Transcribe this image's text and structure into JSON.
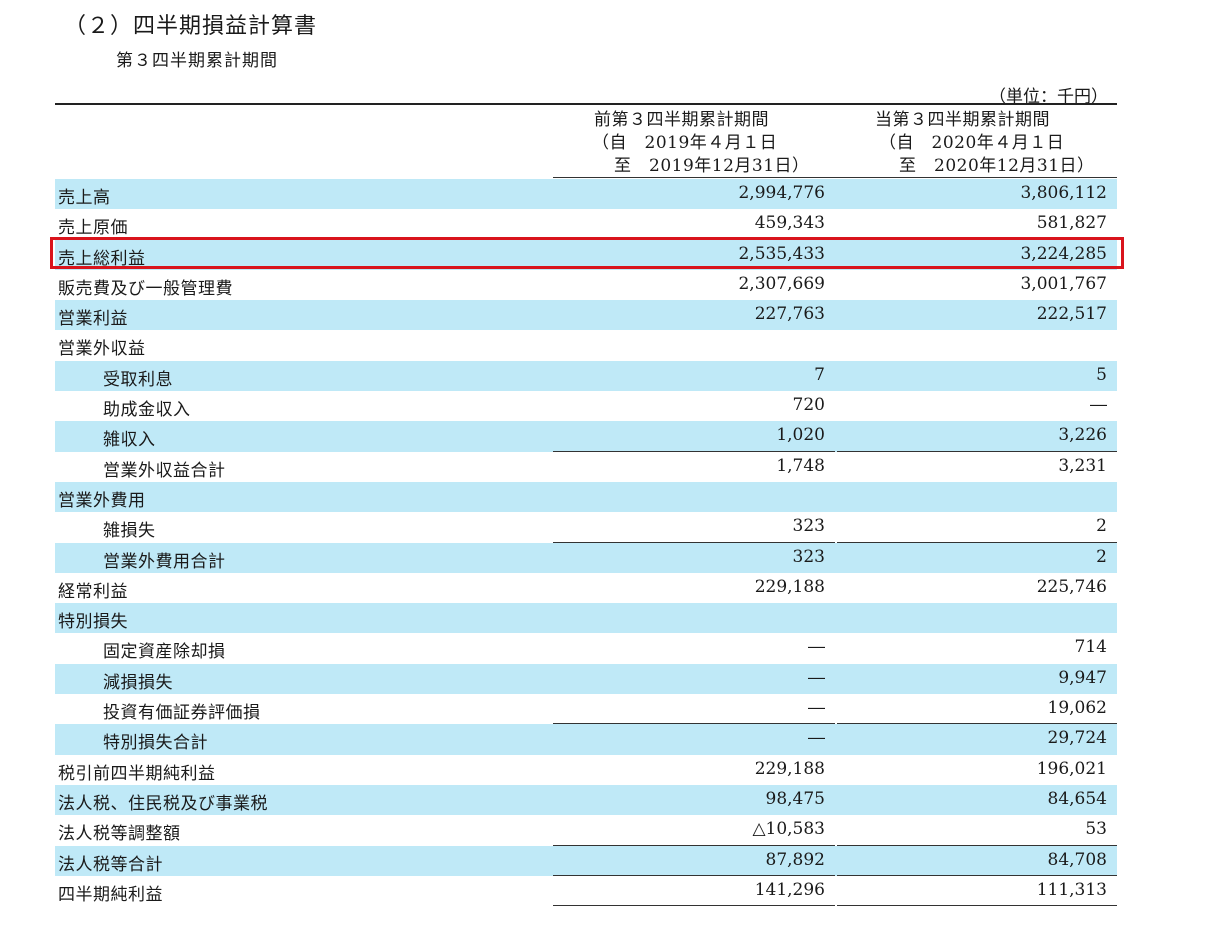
{
  "title": "（２）四半期損益計算書",
  "subtitle": "第３四半期累計期間",
  "unit": "（単位：千円）",
  "columns": {
    "prev": {
      "line1": "前第３四半期累計期間",
      "line2": "（自　2019年４月１日",
      "line3": "至　2019年12月31日）"
    },
    "curr": {
      "line1": "当第３四半期累計期間",
      "line2": "（自　2020年４月１日",
      "line3": "至　2020年12月31日）"
    }
  },
  "highlight_color": "#d9141c",
  "band_color": "#bfe9f7",
  "rows": [
    {
      "label": "売上高",
      "prev": "2,994,776",
      "curr": "3,806,112",
      "indent": false,
      "blue": true,
      "rule_prev": false,
      "rule_curr": false
    },
    {
      "label": "売上原価",
      "prev": "459,343",
      "curr": "581,827",
      "indent": false,
      "blue": false,
      "rule_prev": false,
      "rule_curr": false
    },
    {
      "label": "売上総利益",
      "prev": "2,535,433",
      "curr": "3,224,285",
      "indent": false,
      "blue": true,
      "rule_prev": false,
      "rule_curr": false,
      "highlighted": true
    },
    {
      "label": "販売費及び一般管理費",
      "prev": "2,307,669",
      "curr": "3,001,767",
      "indent": false,
      "blue": false,
      "rule_prev": false,
      "rule_curr": false
    },
    {
      "label": "営業利益",
      "prev": "227,763",
      "curr": "222,517",
      "indent": false,
      "blue": true,
      "rule_prev": false,
      "rule_curr": false
    },
    {
      "label": "営業外収益",
      "prev": "",
      "curr": "",
      "indent": false,
      "blue": false,
      "rule_prev": false,
      "rule_curr": false
    },
    {
      "label": "受取利息",
      "prev": "7",
      "curr": "5",
      "indent": true,
      "blue": true,
      "rule_prev": false,
      "rule_curr": false
    },
    {
      "label": "助成金収入",
      "prev": "720",
      "curr": "―",
      "indent": true,
      "blue": false,
      "rule_prev": false,
      "rule_curr": false
    },
    {
      "label": "雑収入",
      "prev": "1,020",
      "curr": "3,226",
      "indent": true,
      "blue": true,
      "rule_prev": true,
      "rule_curr": true
    },
    {
      "label": "営業外収益合計",
      "prev": "1,748",
      "curr": "3,231",
      "indent": true,
      "blue": false,
      "rule_prev": false,
      "rule_curr": false
    },
    {
      "label": "営業外費用",
      "prev": "",
      "curr": "",
      "indent": false,
      "blue": true,
      "rule_prev": false,
      "rule_curr": false
    },
    {
      "label": "雑損失",
      "prev": "323",
      "curr": "2",
      "indent": true,
      "blue": false,
      "rule_prev": true,
      "rule_curr": true
    },
    {
      "label": "営業外費用合計",
      "prev": "323",
      "curr": "2",
      "indent": true,
      "blue": true,
      "rule_prev": false,
      "rule_curr": false
    },
    {
      "label": "経常利益",
      "prev": "229,188",
      "curr": "225,746",
      "indent": false,
      "blue": false,
      "rule_prev": false,
      "rule_curr": false
    },
    {
      "label": "特別損失",
      "prev": "",
      "curr": "",
      "indent": false,
      "blue": true,
      "rule_prev": false,
      "rule_curr": false
    },
    {
      "label": "固定資産除却損",
      "prev": "―",
      "curr": "714",
      "indent": true,
      "blue": false,
      "rule_prev": false,
      "rule_curr": false
    },
    {
      "label": "減損損失",
      "prev": "―",
      "curr": "9,947",
      "indent": true,
      "blue": true,
      "rule_prev": false,
      "rule_curr": false
    },
    {
      "label": "投資有価証券評価損",
      "prev": "―",
      "curr": "19,062",
      "indent": true,
      "blue": false,
      "rule_prev": true,
      "rule_curr": true
    },
    {
      "label": "特別損失合計",
      "prev": "―",
      "curr": "29,724",
      "indent": true,
      "blue": true,
      "rule_prev": false,
      "rule_curr": false
    },
    {
      "label": "税引前四半期純利益",
      "prev": "229,188",
      "curr": "196,021",
      "indent": false,
      "blue": false,
      "rule_prev": false,
      "rule_curr": false
    },
    {
      "label": "法人税、住民税及び事業税",
      "prev": "98,475",
      "curr": "84,654",
      "indent": false,
      "blue": true,
      "rule_prev": false,
      "rule_curr": false
    },
    {
      "label": "法人税等調整額",
      "prev": "△10,583",
      "curr": "53",
      "indent": false,
      "blue": false,
      "rule_prev": true,
      "rule_curr": true
    },
    {
      "label": "法人税等合計",
      "prev": "87,892",
      "curr": "84,708",
      "indent": false,
      "blue": true,
      "rule_prev": true,
      "rule_curr": true
    },
    {
      "label": "四半期純利益",
      "prev": "141,296",
      "curr": "111,313",
      "indent": false,
      "blue": false,
      "rule_prev": true,
      "rule_curr": true
    }
  ]
}
